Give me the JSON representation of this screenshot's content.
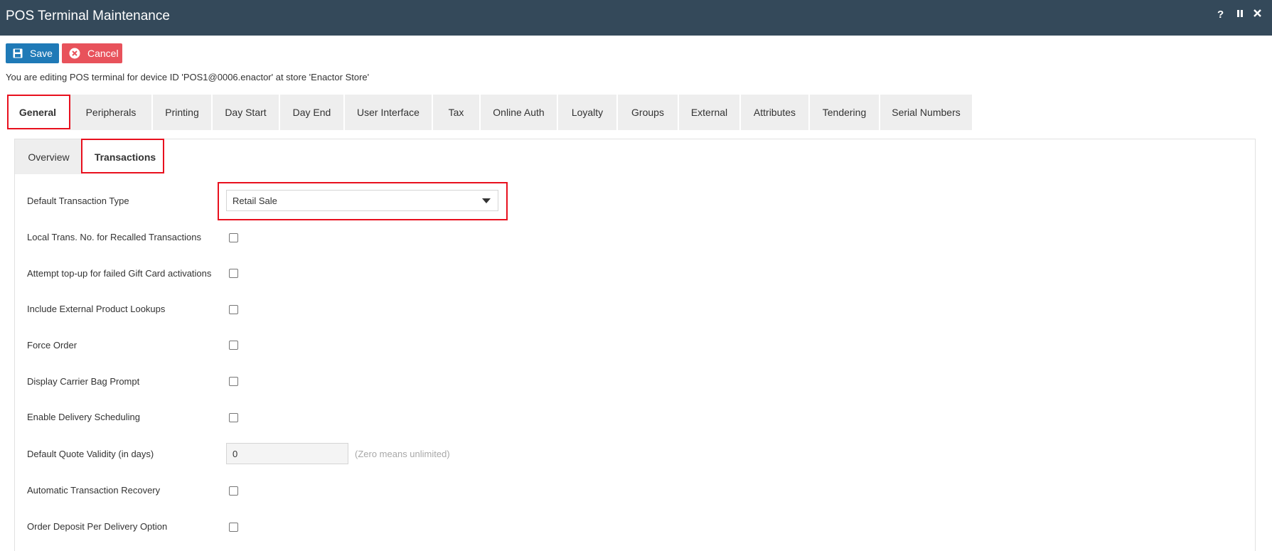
{
  "window": {
    "title": "POS Terminal Maintenance",
    "controls": {
      "help": "?",
      "pause": "II",
      "close": "✕"
    }
  },
  "toolbar": {
    "save_label": "Save",
    "cancel_label": "Cancel"
  },
  "edit_info": "You are editing POS terminal for device ID 'POS1@0006.enactor' at store 'Enactor Store'",
  "tabs": [
    {
      "label": "General",
      "active": true
    },
    {
      "label": "Peripherals"
    },
    {
      "label": "Printing"
    },
    {
      "label": "Day Start"
    },
    {
      "label": "Day End"
    },
    {
      "label": "User Interface"
    },
    {
      "label": "Tax"
    },
    {
      "label": "Online Auth"
    },
    {
      "label": "Loyalty"
    },
    {
      "label": "Groups"
    },
    {
      "label": "External"
    },
    {
      "label": "Attributes"
    },
    {
      "label": "Tendering"
    },
    {
      "label": "Serial Numbers"
    }
  ],
  "subtabs": [
    {
      "label": "Overview"
    },
    {
      "label": "Transactions",
      "active": true
    }
  ],
  "form": {
    "default_transaction_type": {
      "label": "Default Transaction Type",
      "value": "Retail Sale"
    },
    "local_trans_no": {
      "label": "Local Trans. No. for Recalled Transactions",
      "checked": false
    },
    "attempt_topup": {
      "label": "Attempt top-up for failed Gift Card activations",
      "checked": false
    },
    "include_external": {
      "label": "Include External Product Lookups",
      "checked": false
    },
    "force_order": {
      "label": "Force Order",
      "checked": false
    },
    "display_carrier_bag": {
      "label": "Display Carrier Bag Prompt",
      "checked": false
    },
    "enable_delivery_scheduling": {
      "label": "Enable Delivery Scheduling",
      "checked": false
    },
    "default_quote_validity": {
      "label": "Default Quote Validity (in days)",
      "value": "0",
      "hint": "(Zero means unlimited)"
    },
    "automatic_transaction_recovery": {
      "label": "Automatic Transaction Recovery",
      "checked": false
    },
    "order_deposit_per_delivery": {
      "label": "Order Deposit Per Delivery Option",
      "checked": false
    }
  },
  "colors": {
    "titlebar": "#34495a",
    "save": "#1f7ab7",
    "cancel": "#e8525b",
    "highlight": "#e8101e"
  }
}
